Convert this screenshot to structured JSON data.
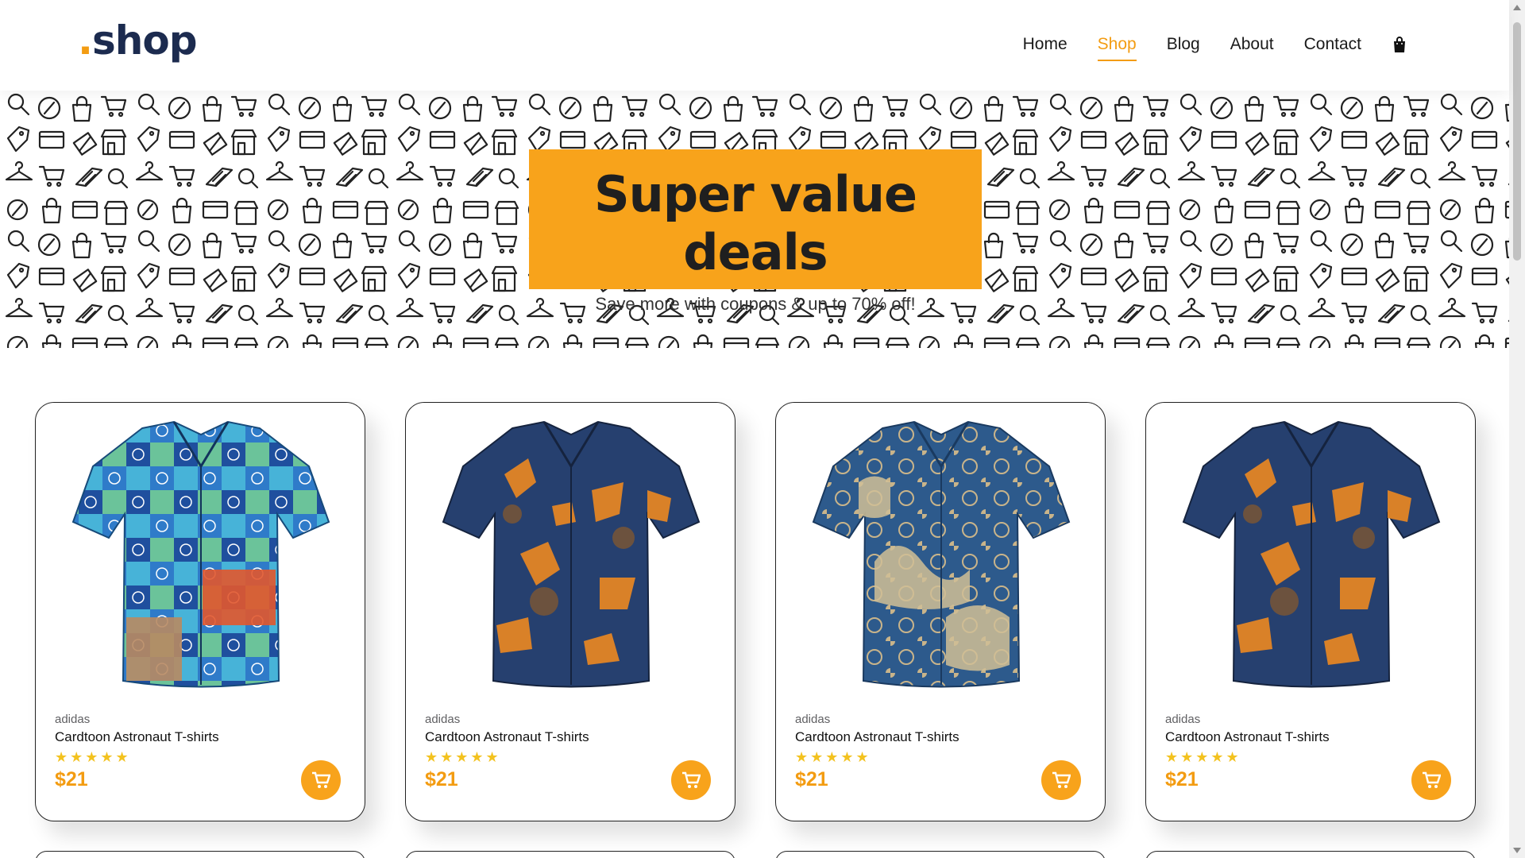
{
  "header": {
    "logo_dot": ".",
    "logo_text": "shop",
    "nav": [
      {
        "label": "Home",
        "active": false
      },
      {
        "label": "Shop",
        "active": true
      },
      {
        "label": "Blog",
        "active": false
      },
      {
        "label": "About",
        "active": false
      },
      {
        "label": "Contact",
        "active": false
      }
    ],
    "cart_icon": "shopping-bag-icon"
  },
  "hero": {
    "title": "Super value deals",
    "subtitle": "Save more with coupons & up to 70% off!",
    "pattern_icons": [
      "magnifier-icon",
      "percent-icon",
      "shopping-bag-icon",
      "cart-icon",
      "credit-card-icon",
      "gift-icon",
      "tag-icon",
      "store-icon",
      "hanger-icon"
    ]
  },
  "products": [
    {
      "brand": "adidas",
      "name": "Cardtoon Astronaut T-shirts",
      "stars": "★★★★★",
      "price": "$21",
      "shirt": "patchwork-blue"
    },
    {
      "brand": "adidas",
      "name": "Cardtoon Astronaut T-shirts",
      "stars": "★★★★★",
      "price": "$21",
      "shirt": "orange-leaf"
    },
    {
      "brand": "adidas",
      "name": "Cardtoon Astronaut T-shirts",
      "stars": "★★★★★",
      "price": "$21",
      "shirt": "blue-tan"
    },
    {
      "brand": "adidas",
      "name": "Cardtoon Astronaut T-shirts",
      "stars": "★★★★★",
      "price": "$21",
      "shirt": "orange-leaf"
    }
  ],
  "colors": {
    "accent": "#f8a31b",
    "accent_text": "#f39c12",
    "star": "#f3c21f",
    "logo": "#1c2b4f"
  }
}
